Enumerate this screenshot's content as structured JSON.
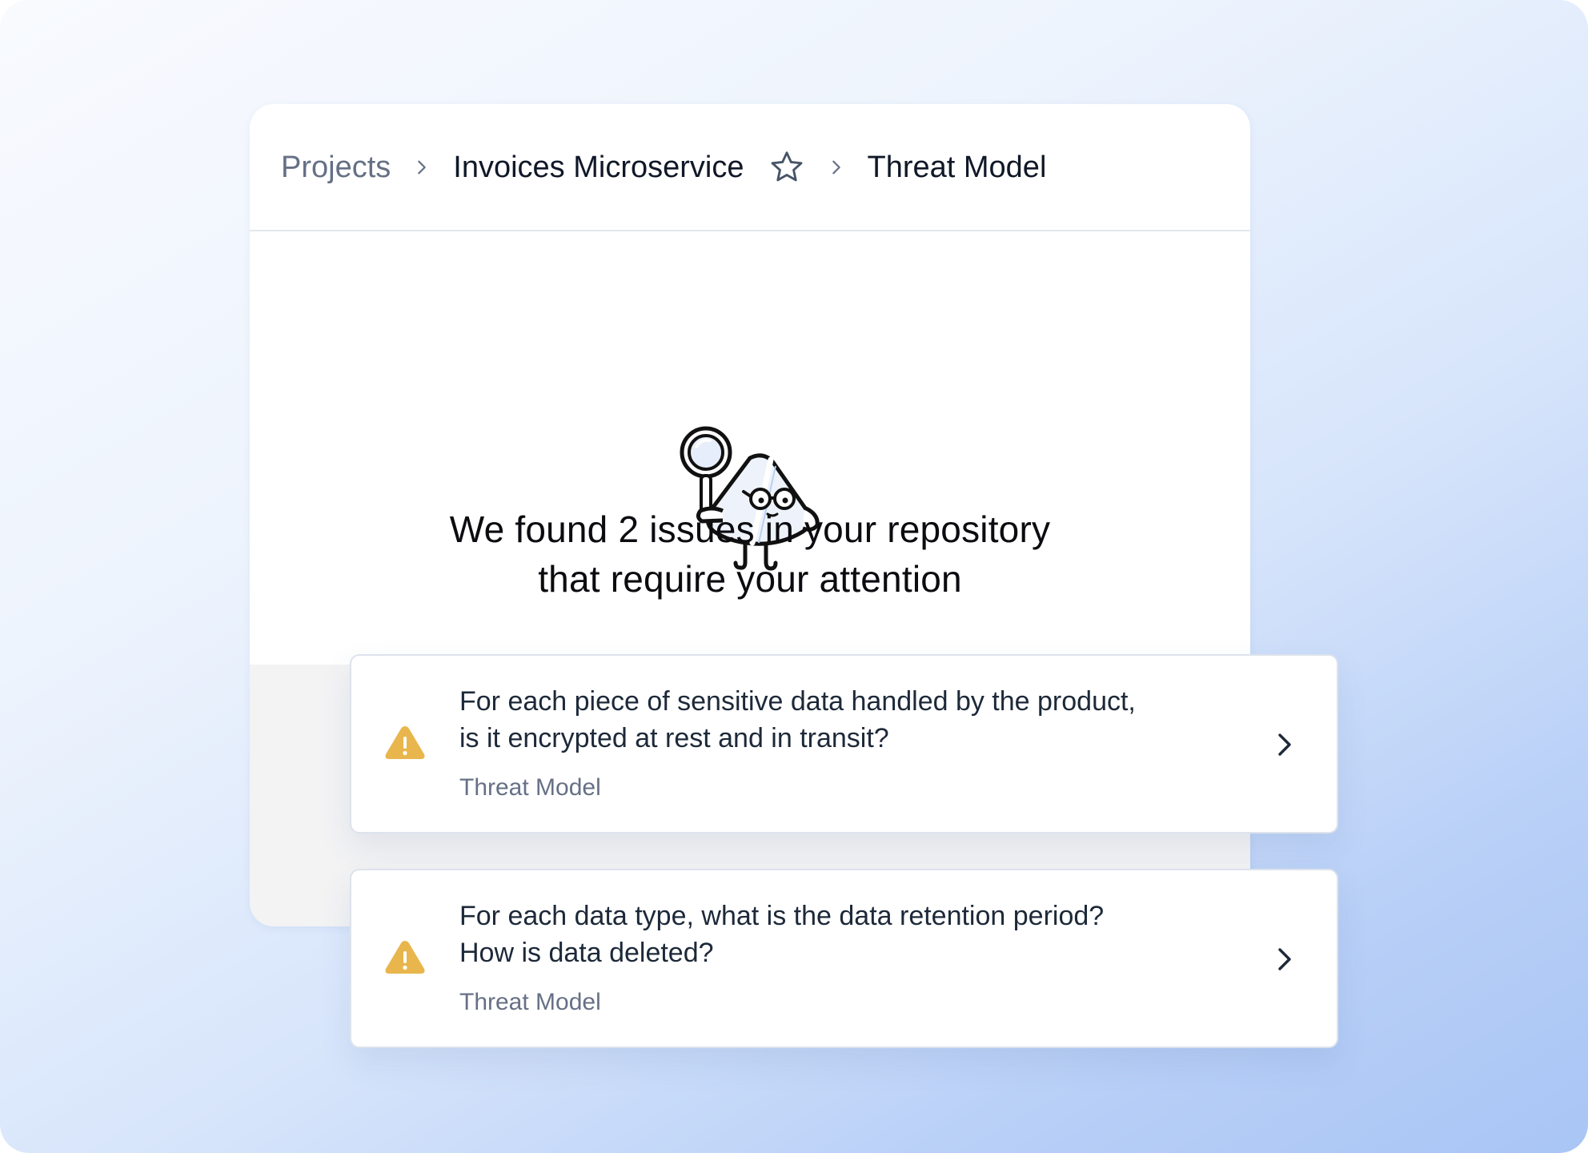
{
  "breadcrumb": {
    "items": [
      {
        "label": "Projects"
      },
      {
        "label": "Invoices Microservice"
      },
      {
        "label": "Threat Model"
      }
    ]
  },
  "headline": {
    "line1": "We found 2 issues in your repository",
    "line2": "that require your attention"
  },
  "issues": [
    {
      "question_line1": "For each piece of sensitive data handled by the product,",
      "question_line2": "is it encrypted at rest and in transit?",
      "category": "Threat Model",
      "icon": "warning-icon"
    },
    {
      "question_line1": "For each data type, what is the data retention period?",
      "question_line2": "How is data deleted?",
      "category": "Threat Model",
      "icon": "warning-icon"
    }
  ],
  "colors": {
    "warning": "#E8B64C",
    "text_primary": "#101828",
    "text_muted": "#667085",
    "border": "#DDE3EC"
  }
}
